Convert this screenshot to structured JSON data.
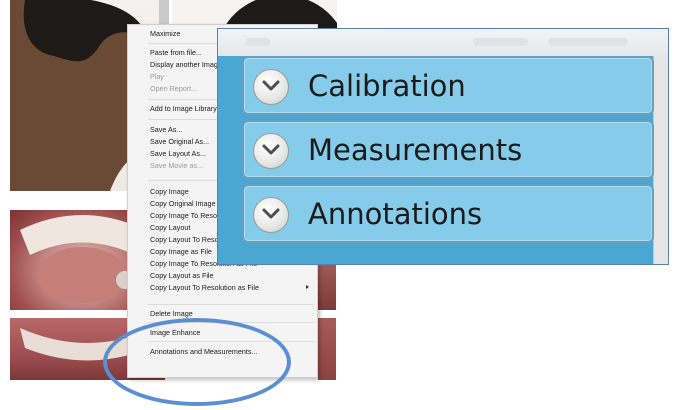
{
  "context_menu": {
    "items": [
      {
        "label": "Maximize"
      },
      {
        "label": "Paste from file..."
      },
      {
        "label": "Display another Imag"
      },
      {
        "label": "Play"
      },
      {
        "label": "Open Report..."
      },
      {
        "label": "Add to Image Library"
      },
      {
        "label": "Save As..."
      },
      {
        "label": "Save Original As..."
      },
      {
        "label": "Save Layout As..."
      },
      {
        "label": "Save Movie as..."
      },
      {
        "label": "Copy Image"
      },
      {
        "label": "Copy Original Image"
      },
      {
        "label": "Copy Image To Reso"
      },
      {
        "label": "Copy Layout"
      },
      {
        "label": "Copy Layout To Reso"
      },
      {
        "label": "Copy Image as File"
      },
      {
        "label": "Copy Image To Resolution as File"
      },
      {
        "label": "Copy Layout as File"
      },
      {
        "label": "Copy Layout To Resolution as File"
      },
      {
        "label": "Delete Image"
      },
      {
        "label": "Image Enhance"
      },
      {
        "label": "Annotations and Measurements..."
      }
    ]
  },
  "zoom_panel": {
    "sections": [
      {
        "label": "Calibration",
        "icon": "chevron-down-icon"
      },
      {
        "label": "Measurements",
        "icon": "chevron-down-icon"
      },
      {
        "label": "Annotations",
        "icon": "chevron-down-icon"
      }
    ]
  },
  "colors": {
    "section_fill": "#86ccea",
    "highlight": "#5b8fd1"
  }
}
